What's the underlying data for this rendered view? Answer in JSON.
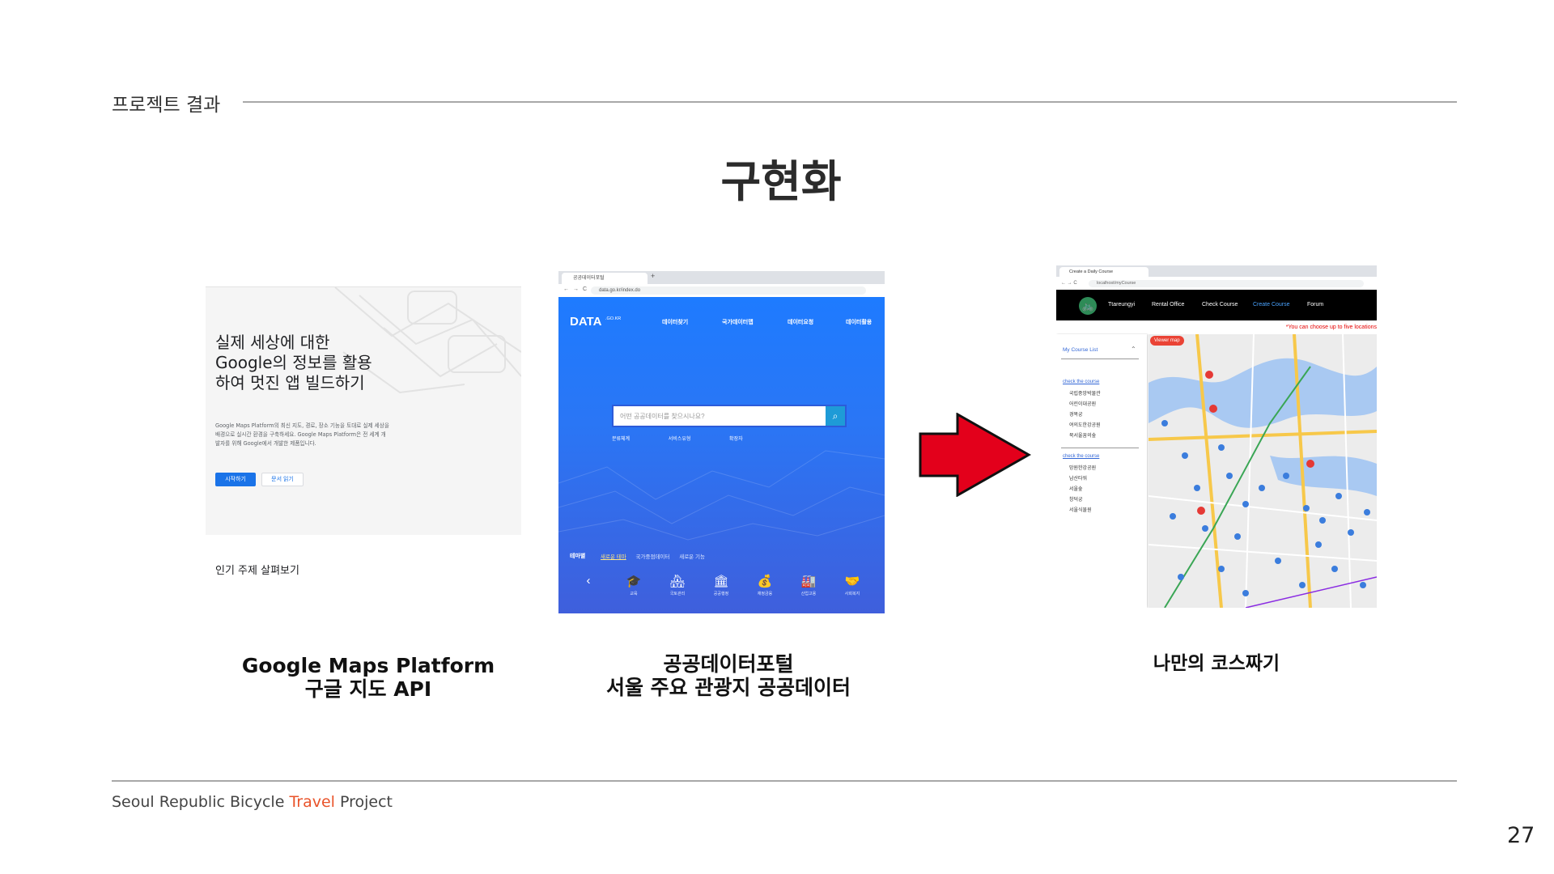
{
  "header": {
    "section_label": "프로젝트 결과",
    "title": "구현화"
  },
  "panels": [
    {
      "caption_line1": "Google Maps Platform",
      "caption_line2": "구글 지도 API",
      "screenshot": {
        "heading": "실제 세상에 대한 Google의 정보를 활용하여 멋진 앱 빌드하기",
        "description": "Google Maps Platform의 최신 지도, 경로, 장소 기능을 토대로 실제 세상을 배경으로 실시간 환경을 구축하세요. Google Maps Platform은 전 세계 개발자를 위해 Google에서 개발한 제품입니다.",
        "primary_button": "시작하기",
        "secondary_button": "문서 읽기",
        "popular_topics": "인기 주제 살펴보기"
      }
    },
    {
      "caption_line1": "공공데이터포털",
      "caption_line2": "서울 주요 관광지 공공데이터",
      "screenshot": {
        "tab_title": "공공데이터포털",
        "url": "data.go.kr/index.do",
        "logo": "DATA",
        "logo_sub": ".GO.KR",
        "menu": [
          "데이터찾기",
          "국가데이터맵",
          "데이터요청",
          "데이터활용"
        ],
        "search_placeholder": "어떤 공공데이터를 찾으시나요?",
        "filters": [
          "분류체계",
          "서비스유형",
          "확장자"
        ],
        "theme_label": "테마별",
        "theme_tabs": [
          "새로운 테마",
          "국가중점데이터",
          "새로운 기능"
        ],
        "icons": [
          {
            "name": "graduation-cap-icon",
            "glyph": "🎓",
            "label": "교육"
          },
          {
            "name": "land-icon",
            "glyph": "🏘",
            "label": "국토관리"
          },
          {
            "name": "government-icon",
            "glyph": "🏛",
            "label": "공공행정"
          },
          {
            "name": "finance-icon",
            "glyph": "💰",
            "label": "재정금융"
          },
          {
            "name": "industry-icon",
            "glyph": "🏭",
            "label": "산업고용"
          },
          {
            "name": "welfare-icon",
            "glyph": "🤝",
            "label": "사회복지"
          }
        ]
      }
    },
    {
      "caption_line1": "나만의 코스짜기",
      "caption_line2": "",
      "screenshot": {
        "tab_title": "Create a Daily Course",
        "url": "localhost/myCourse",
        "nav": [
          "Ttareungyi",
          "Rental Office",
          "Check Course",
          "Create Course",
          "Forum"
        ],
        "note": "*You can choose up to five locations",
        "sidebar_header": "My Course List",
        "check_course_label": "check the course",
        "check_items": [
          "국립중앙박물관",
          "어린이대공원",
          "경복궁",
          "여의도한강공원",
          "북서울꿈의숲"
        ],
        "second_label": "check the course",
        "second_items": [
          "망원한강공원",
          "남산타워",
          "서울숲",
          "창덕궁",
          "서울식물원"
        ],
        "map_button": "Viewer map"
      }
    }
  ],
  "footer": {
    "prefix": "Seoul Republic Bicycle ",
    "accent": "Travel",
    "suffix": " Project",
    "accent_color": "#e9532a",
    "page_number": "27"
  },
  "colors": {
    "arrow_fill": "#e3001b",
    "rule": "#a8a8a8",
    "data_portal_blue": "#2a76f5"
  }
}
